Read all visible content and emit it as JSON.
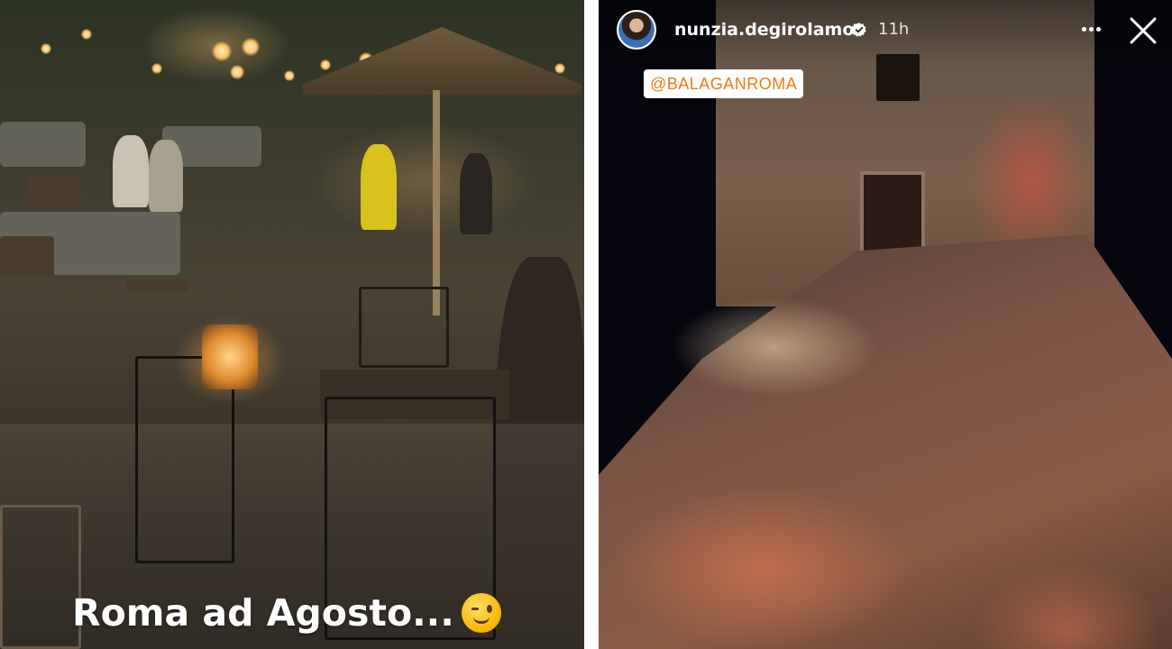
{
  "left_story": {
    "caption": "Roma ad Agosto...",
    "caption_emoji": "winking-face-emoji"
  },
  "right_story": {
    "header": {
      "username": "nunzia.degirolamo",
      "verified_icon": "verified-badge-icon",
      "time": "11h",
      "more_icon": "more-options-icon",
      "close_icon": "close-icon"
    },
    "mention_sticker": "@BALAGANROMA"
  },
  "colors": {
    "mention_text": "#f07a12",
    "verified_badge": "#ffffff"
  }
}
